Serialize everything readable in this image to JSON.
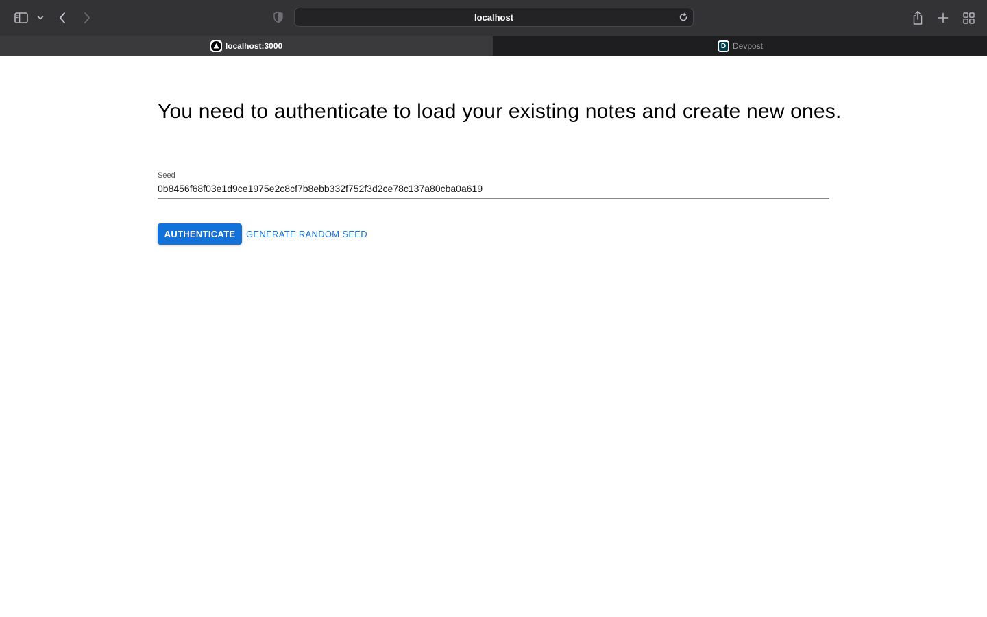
{
  "browser": {
    "address": "localhost",
    "tabs": [
      {
        "label": "localhost:3000",
        "favicon": "vercel-triangle-icon",
        "active": true
      },
      {
        "label": "Devpost",
        "favicon": "devpost-icon",
        "active": false
      }
    ],
    "colors": {
      "toolbar": "#333336",
      "tabbar": "#1e1e20",
      "active_tab": "#3a3a3d"
    }
  },
  "main": {
    "title": "You need to authenticate to load your existing notes and create new ones.",
    "seed": {
      "label": "Seed",
      "value": "0b8456f68f03e1d9ce1975e2c8cf7b8ebb332f752f3d2ce78c137a80cba0a619"
    },
    "authenticate_label": "AUTHENTICATE",
    "generate_label": "GENERATE RANDOM SEED"
  },
  "colors": {
    "primary": "#1372d9"
  }
}
